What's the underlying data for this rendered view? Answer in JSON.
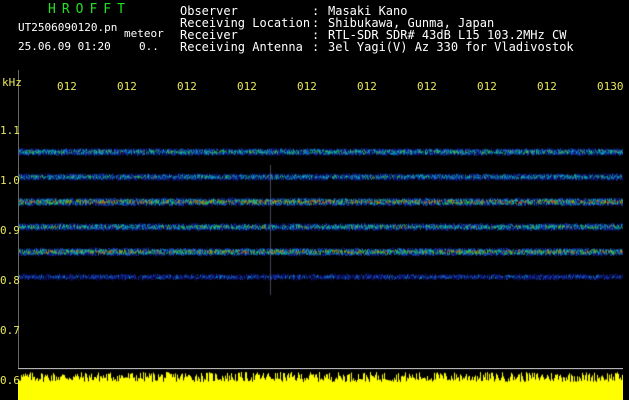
{
  "header": {
    "app_title": "HROFFT",
    "file_name": "UT2506090120.pn",
    "mode": "meteor",
    "date_time": "25.06.09 01:20",
    "extra": "0..",
    "info": [
      {
        "label": "Observer",
        "sep": ":",
        "value": "Masaki Kano"
      },
      {
        "label": "Receiving Location",
        "sep": ":",
        "value": "Shibukawa, Gunma, Japan"
      },
      {
        "label": "Receiver",
        "sep": ":",
        "value": "RTL-SDR SDR# 43dB L15 103.2MHz CW"
      },
      {
        "label": "Receiving Antenna",
        "sep": ":",
        "value": "3el Yagi(V) Az 330 for Vladivostok"
      }
    ]
  },
  "axes": {
    "y_unit": "kHz",
    "y_ticks": [
      "1.1",
      "1.0",
      "0.9",
      "0.8",
      "0.7",
      "0.6"
    ],
    "x_ticks": [
      "012",
      "012",
      "012",
      "012",
      "012",
      "012",
      "012",
      "012",
      "012",
      "0130"
    ]
  },
  "spectrogram": {
    "bands_khz": [
      1.025,
      0.975,
      0.925,
      0.875,
      0.825,
      0.775
    ],
    "intensity": [
      0.6,
      0.5,
      0.85,
      0.6,
      0.8,
      0.3
    ]
  },
  "colors": {
    "background": "#000000",
    "title": "#22e022",
    "axis_text": "#e8e85a",
    "histogram": "#ffff00"
  }
}
